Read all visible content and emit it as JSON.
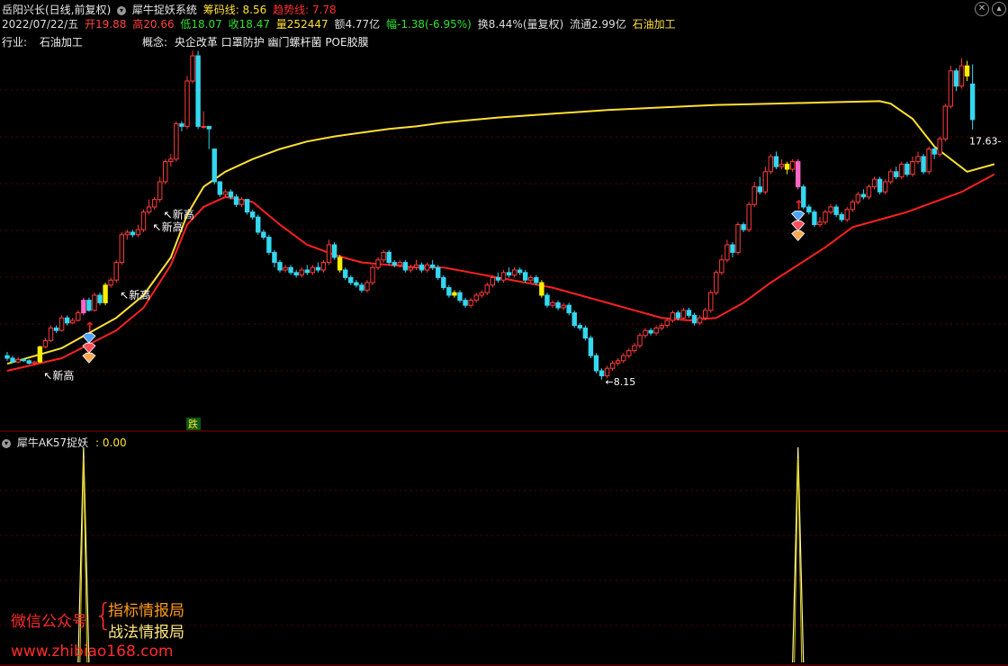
{
  "colors": {
    "background": "#000000",
    "up": "#ff3b3b",
    "down": "#34d7f0",
    "trend_line": "#ffe033",
    "cost_line": "#ff2020",
    "grid": "#5a0000",
    "highlight_yellow": "#ffee00",
    "highlight_pink": "#ff66c4",
    "label_gold": "#ffd28c"
  },
  "header": {
    "stock_name": "岳阳兴长(日线,前复权)",
    "indicator_name": "犀牛捉妖系统",
    "chip_line": "筹码线: 8.56",
    "trend_line": "趋势线: 7.78",
    "date": "2022/07/22/五",
    "open": "开19.88",
    "high": "高20.66",
    "low": "低18.07",
    "close": "收18.47",
    "volume": "量252447",
    "amount": "额4.77亿",
    "change": "幅-1.38(-6.95%)",
    "turnover": "换8.44%(量复权)",
    "float": "流通2.99亿",
    "sector": "石油加工"
  },
  "info": {
    "industry_label": "行业:",
    "industry_value": "石油加工",
    "concept_label": "概念:",
    "concept_value": "央企改革 口罩防护 幽门螺杆菌 POE胶膜"
  },
  "annotations": {
    "new_high": "新高",
    "limit_down": "跌",
    "low_price": "8.15",
    "last_price": "17.63"
  },
  "sub_panel": {
    "title": "犀牛AK57捉妖",
    "value": ": 0.00"
  },
  "watermark": {
    "wechat": "微信公众号",
    "line1": "指标情报局",
    "line2": "战法情报局",
    "url": "www.zhibiao168.com"
  },
  "chart_data": [
    {
      "type": "candlestick",
      "title": "岳阳兴长(日线,前复权)",
      "y_range": [
        6.5,
        21.5
      ],
      "candles": [
        [
          9.1,
          9.0,
          9.25,
          8.9
        ],
        [
          9.0,
          8.85,
          9.1,
          8.8
        ],
        [
          8.85,
          8.95,
          9.05,
          8.8
        ],
        [
          8.95,
          8.9,
          9.0,
          8.85
        ],
        [
          8.9,
          8.8,
          8.95,
          8.75
        ],
        [
          8.8,
          8.85,
          8.9,
          8.7
        ],
        [
          8.85,
          9.45,
          9.5,
          8.8
        ],
        [
          9.45,
          9.7,
          9.8,
          9.4
        ],
        [
          9.7,
          10.2,
          10.3,
          9.65
        ],
        [
          10.2,
          10.1,
          10.3,
          10.0
        ],
        [
          10.1,
          10.6,
          10.7,
          10.05
        ],
        [
          10.6,
          10.4,
          10.7,
          10.3
        ],
        [
          10.4,
          10.5,
          10.6,
          10.35
        ],
        [
          10.5,
          10.8,
          10.9,
          10.45
        ],
        [
          10.8,
          11.3,
          11.4,
          10.7
        ],
        [
          11.3,
          10.9,
          11.4,
          10.85
        ],
        [
          10.9,
          11.5,
          11.6,
          10.85
        ],
        [
          11.5,
          11.2,
          11.6,
          11.1
        ],
        [
          11.2,
          11.9,
          12.0,
          11.1
        ],
        [
          11.9,
          12.1,
          12.2,
          11.8
        ],
        [
          12.1,
          12.8,
          12.9,
          12.0
        ],
        [
          12.8,
          13.9,
          14.0,
          12.7
        ],
        [
          13.9,
          14.0,
          14.1,
          13.7
        ],
        [
          14.0,
          13.9,
          14.1,
          13.8
        ],
        [
          13.9,
          14.1,
          14.3,
          13.8
        ],
        [
          14.1,
          14.8,
          14.9,
          14.0
        ],
        [
          14.8,
          15.0,
          15.3,
          14.7
        ],
        [
          15.0,
          15.3,
          15.4,
          14.9
        ],
        [
          15.3,
          16.0,
          16.2,
          15.2
        ],
        [
          16.0,
          16.8,
          16.9,
          15.9
        ],
        [
          16.8,
          16.9,
          17.1,
          16.6
        ],
        [
          16.9,
          18.3,
          18.4,
          16.8
        ],
        [
          18.3,
          18.2,
          18.4,
          18.0
        ],
        [
          18.2,
          20.0,
          20.2,
          18.1
        ],
        [
          20.0,
          21.0,
          21.2,
          19.9
        ],
        [
          21.0,
          18.2,
          21.2,
          18.1
        ],
        [
          18.2,
          18.2,
          18.8,
          18.1
        ],
        [
          18.2,
          18.1,
          18.2,
          17.3
        ],
        [
          17.3,
          16.0,
          17.3,
          15.9
        ],
        [
          16.0,
          15.5,
          16.0,
          15.4
        ],
        [
          15.5,
          15.6,
          15.7,
          15.4
        ],
        [
          15.6,
          15.4,
          15.7,
          15.3
        ],
        [
          15.4,
          15.1,
          15.5,
          15.0
        ],
        [
          15.1,
          15.3,
          15.4,
          15.0
        ],
        [
          15.3,
          14.8,
          15.3,
          14.7
        ],
        [
          14.8,
          14.6,
          14.9,
          14.5
        ],
        [
          14.6,
          14.0,
          14.7,
          13.9
        ],
        [
          14.0,
          13.8,
          14.1,
          13.7
        ],
        [
          13.8,
          13.2,
          13.9,
          13.1
        ],
        [
          13.2,
          12.8,
          13.3,
          12.6
        ],
        [
          12.8,
          12.5,
          12.9,
          12.4
        ],
        [
          12.5,
          12.6,
          12.7,
          12.4
        ],
        [
          12.6,
          12.4,
          12.7,
          12.3
        ],
        [
          12.4,
          12.3,
          12.5,
          12.2
        ],
        [
          12.3,
          12.5,
          12.6,
          12.2
        ],
        [
          12.5,
          12.4,
          12.7,
          12.3
        ],
        [
          12.4,
          12.6,
          12.7,
          12.3
        ],
        [
          12.6,
          12.5,
          12.8,
          12.4
        ],
        [
          12.5,
          12.8,
          12.9,
          12.4
        ],
        [
          12.8,
          13.5,
          13.7,
          12.7
        ],
        [
          13.5,
          13.0,
          13.6,
          12.9
        ],
        [
          13.0,
          12.5,
          13.1,
          12.4
        ],
        [
          12.5,
          12.2,
          12.6,
          12.1
        ],
        [
          12.2,
          12.0,
          12.3,
          11.9
        ],
        [
          12.0,
          11.9,
          12.1,
          11.8
        ],
        [
          11.9,
          11.7,
          12.0,
          11.6
        ],
        [
          11.7,
          12.0,
          12.1,
          11.6
        ],
        [
          12.0,
          12.6,
          12.7,
          11.9
        ],
        [
          12.6,
          12.9,
          13.0,
          12.5
        ],
        [
          12.9,
          13.2,
          13.3,
          12.8
        ],
        [
          13.2,
          12.8,
          13.3,
          12.7
        ],
        [
          12.8,
          12.7,
          12.9,
          12.6
        ],
        [
          12.7,
          12.8,
          12.9,
          12.6
        ],
        [
          12.8,
          12.5,
          12.9,
          12.4
        ],
        [
          12.5,
          12.6,
          12.7,
          12.4
        ],
        [
          12.6,
          12.7,
          12.9,
          12.5
        ],
        [
          12.7,
          12.5,
          12.8,
          12.4
        ],
        [
          12.5,
          12.7,
          12.8,
          12.4
        ],
        [
          12.7,
          12.6,
          12.9,
          12.5
        ],
        [
          12.6,
          12.2,
          12.7,
          12.1
        ],
        [
          12.2,
          11.8,
          12.3,
          11.7
        ],
        [
          11.8,
          11.5,
          11.9,
          11.4
        ],
        [
          11.5,
          11.6,
          11.7,
          11.4
        ],
        [
          11.6,
          11.3,
          11.7,
          11.2
        ],
        [
          11.3,
          11.1,
          11.4,
          11.0
        ],
        [
          11.1,
          11.3,
          11.4,
          11.0
        ],
        [
          11.3,
          11.5,
          11.6,
          11.2
        ],
        [
          11.5,
          11.6,
          11.7,
          11.4
        ],
        [
          11.6,
          11.9,
          12.0,
          11.5
        ],
        [
          11.9,
          12.2,
          12.3,
          11.8
        ],
        [
          12.2,
          12.1,
          12.4,
          12.0
        ],
        [
          12.1,
          12.4,
          12.5,
          12.0
        ],
        [
          12.4,
          12.3,
          12.6,
          12.2
        ],
        [
          12.3,
          12.5,
          12.6,
          12.2
        ],
        [
          12.5,
          12.4,
          12.6,
          12.3
        ],
        [
          12.4,
          12.1,
          12.5,
          12.0
        ],
        [
          12.1,
          12.2,
          12.3,
          12.0
        ],
        [
          12.2,
          12.0,
          12.3,
          11.9
        ],
        [
          12.0,
          11.5,
          12.1,
          11.4
        ],
        [
          11.5,
          11.1,
          11.6,
          11.0
        ],
        [
          11.1,
          11.2,
          11.3,
          11.0
        ],
        [
          11.2,
          11.0,
          11.3,
          10.9
        ],
        [
          11.0,
          11.1,
          11.2,
          10.9
        ],
        [
          11.1,
          10.8,
          11.2,
          10.7
        ],
        [
          10.8,
          10.3,
          10.9,
          10.2
        ],
        [
          10.3,
          10.2,
          10.4,
          10.1
        ],
        [
          10.2,
          9.8,
          10.3,
          9.7
        ],
        [
          9.8,
          9.1,
          9.9,
          9.0
        ],
        [
          9.1,
          8.5,
          9.2,
          8.4
        ],
        [
          8.5,
          8.3,
          8.6,
          8.15
        ],
        [
          8.3,
          8.6,
          8.7,
          8.2
        ],
        [
          8.6,
          8.8,
          8.9,
          8.5
        ],
        [
          8.8,
          8.9,
          9.0,
          8.7
        ],
        [
          8.9,
          9.1,
          9.2,
          8.8
        ],
        [
          9.1,
          9.3,
          9.4,
          9.0
        ],
        [
          9.3,
          9.5,
          9.6,
          9.2
        ],
        [
          9.5,
          9.9,
          10.0,
          9.4
        ],
        [
          9.9,
          10.1,
          10.2,
          9.8
        ],
        [
          10.1,
          10.0,
          10.2,
          9.9
        ],
        [
          10.0,
          10.2,
          10.3,
          9.9
        ],
        [
          10.2,
          10.3,
          10.4,
          10.1
        ],
        [
          10.3,
          10.5,
          10.6,
          10.2
        ],
        [
          10.5,
          10.8,
          10.9,
          10.4
        ],
        [
          10.8,
          10.6,
          10.9,
          10.5
        ],
        [
          10.6,
          10.9,
          11.0,
          10.5
        ],
        [
          10.9,
          10.7,
          11.0,
          10.6
        ],
        [
          10.7,
          10.4,
          10.8,
          10.3
        ],
        [
          10.4,
          10.6,
          10.7,
          10.3
        ],
        [
          10.6,
          10.9,
          11.0,
          10.5
        ],
        [
          10.9,
          11.6,
          11.7,
          10.8
        ],
        [
          11.6,
          12.4,
          12.5,
          11.5
        ],
        [
          12.4,
          12.9,
          13.1,
          12.3
        ],
        [
          12.9,
          13.5,
          13.7,
          12.8
        ],
        [
          13.5,
          13.2,
          13.6,
          13.0
        ],
        [
          13.2,
          14.3,
          14.4,
          13.1
        ],
        [
          14.3,
          14.1,
          14.4,
          14.0
        ],
        [
          14.1,
          15.1,
          15.2,
          14.0
        ],
        [
          15.1,
          15.8,
          16.0,
          15.0
        ],
        [
          15.8,
          15.6,
          16.2,
          15.5
        ],
        [
          15.6,
          16.4,
          16.6,
          15.5
        ],
        [
          16.4,
          17.0,
          17.1,
          16.3
        ],
        [
          17.0,
          16.6,
          17.2,
          16.5
        ],
        [
          16.6,
          16.7,
          16.9,
          16.5
        ],
        [
          16.7,
          16.5,
          16.8,
          16.3
        ],
        [
          16.5,
          16.8,
          16.9,
          16.4
        ],
        [
          16.8,
          15.8,
          16.9,
          15.7
        ],
        [
          15.8,
          15.0,
          15.9,
          14.9
        ],
        [
          15.0,
          14.8,
          15.1,
          14.7
        ],
        [
          14.8,
          14.3,
          14.9,
          14.2
        ],
        [
          14.3,
          14.4,
          14.6,
          14.2
        ],
        [
          14.4,
          14.8,
          14.9,
          14.3
        ],
        [
          14.8,
          15.0,
          15.1,
          14.7
        ],
        [
          15.0,
          14.7,
          15.1,
          14.6
        ],
        [
          14.7,
          14.5,
          14.8,
          14.4
        ],
        [
          14.5,
          14.9,
          15.0,
          14.4
        ],
        [
          14.9,
          15.2,
          15.3,
          14.8
        ],
        [
          15.2,
          15.5,
          15.6,
          15.1
        ],
        [
          15.5,
          15.4,
          15.7,
          15.3
        ],
        [
          15.4,
          15.8,
          15.9,
          15.3
        ],
        [
          15.8,
          16.1,
          16.2,
          15.7
        ],
        [
          16.1,
          15.6,
          16.2,
          15.5
        ],
        [
          15.6,
          16.0,
          16.1,
          15.5
        ],
        [
          16.0,
          16.4,
          16.5,
          15.9
        ],
        [
          16.4,
          16.2,
          16.6,
          16.1
        ],
        [
          16.2,
          16.7,
          16.8,
          16.1
        ],
        [
          16.7,
          16.3,
          16.8,
          16.2
        ],
        [
          16.3,
          16.8,
          17.0,
          16.2
        ],
        [
          16.8,
          17.0,
          17.2,
          16.7
        ],
        [
          17.0,
          16.4,
          17.1,
          16.3
        ],
        [
          16.4,
          17.3,
          17.4,
          16.3
        ],
        [
          17.3,
          17.1,
          17.4,
          16.9
        ],
        [
          17.1,
          17.7,
          17.8,
          17.0
        ],
        [
          17.7,
          19.0,
          19.1,
          17.6
        ],
        [
          19.0,
          20.4,
          20.6,
          18.9
        ],
        [
          20.4,
          19.8,
          20.5,
          19.6
        ],
        [
          19.8,
          20.6,
          20.9,
          19.7
        ],
        [
          20.6,
          20.2,
          20.8,
          20.0
        ],
        [
          19.88,
          18.47,
          20.66,
          18.07
        ]
      ],
      "highlight_yellow_bars": [
        6,
        18,
        61,
        82,
        98,
        143,
        176
      ],
      "highlight_pink_bars": [
        14,
        145
      ],
      "new_high_labels": [
        6,
        20,
        26,
        28
      ],
      "up_arrow_bars": [
        15,
        145
      ],
      "gem_bars": [
        15,
        145
      ],
      "limit_down_bar": 33,
      "low_point_bar": 109,
      "lines": {
        "trend_line_yellow": {
          "x": [
            0,
            10,
            20,
            25,
            30,
            33,
            36,
            40,
            45,
            50,
            55,
            60,
            65,
            70,
            75,
            80,
            90,
            100,
            110,
            120,
            130,
            140,
            150,
            160,
            162,
            166,
            170,
            176,
            181
          ],
          "y": [
            8.78,
            9.4,
            10.6,
            11.5,
            13.0,
            14.7,
            15.8,
            16.4,
            16.9,
            17.3,
            17.6,
            17.8,
            17.95,
            18.1,
            18.2,
            18.35,
            18.55,
            18.7,
            18.85,
            18.95,
            19.05,
            19.1,
            19.15,
            19.2,
            19.1,
            18.5,
            17.4,
            16.4,
            16.7
          ]
        },
        "cost_line_red": {
          "x": [
            0,
            10,
            20,
            25,
            30,
            33,
            36,
            40,
            45,
            50,
            55,
            60,
            65,
            70,
            75,
            80,
            85,
            90,
            95,
            100,
            105,
            110,
            115,
            120,
            125,
            130,
            135,
            140,
            145,
            150,
            155,
            160,
            165,
            170,
            175,
            181
          ],
          "y": [
            8.5,
            9.0,
            10.1,
            11.0,
            12.7,
            14.3,
            15.0,
            15.4,
            15.2,
            14.3,
            13.5,
            13.1,
            12.8,
            12.7,
            12.6,
            12.6,
            12.4,
            12.2,
            12.0,
            11.8,
            11.5,
            11.2,
            10.9,
            10.6,
            10.5,
            10.6,
            11.2,
            12.0,
            12.7,
            13.4,
            14.2,
            14.5,
            14.8,
            15.2,
            15.6,
            16.3
          ]
        }
      }
    },
    {
      "type": "line",
      "title": "犀牛AK57捉妖",
      "y_range": [
        0,
        100
      ],
      "spikes": [
        14,
        145
      ],
      "values_note_from_header": 0.0
    }
  ]
}
